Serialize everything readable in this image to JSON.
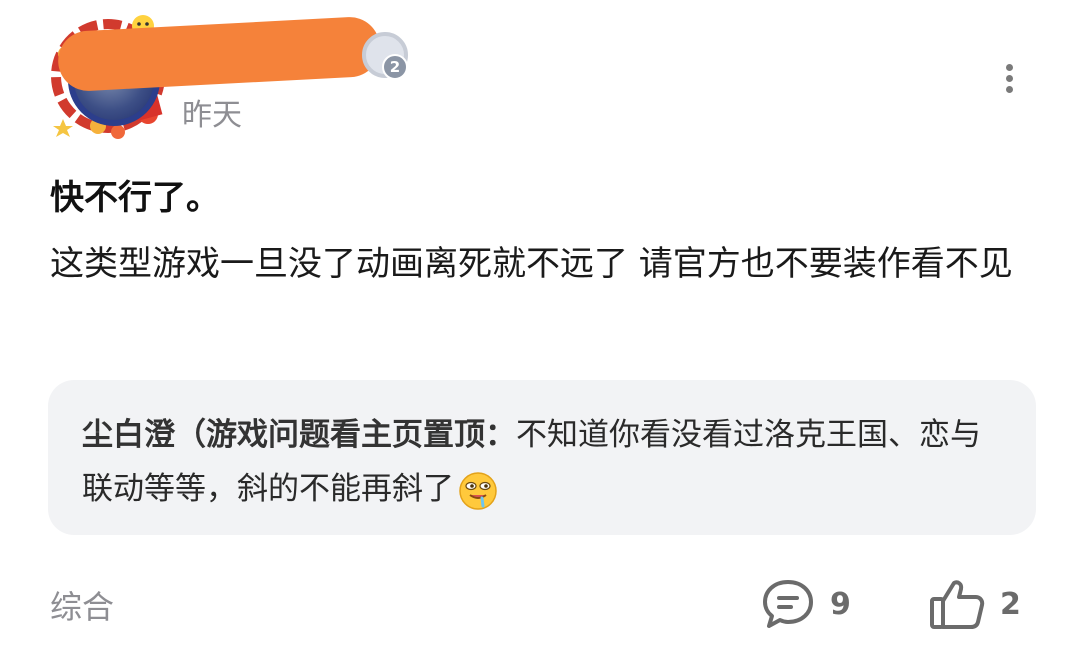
{
  "post": {
    "time": "昨天",
    "title": "快不行了。",
    "body": "这类型游戏一旦没了动画离死就不远了 请官方也不要装作看不见",
    "user_level": "2"
  },
  "quote": {
    "author": "尘白澄（游戏问题看主页置顶：",
    "text": "不知道你看没看过洛克王国、恋与联动等等，斜的不能再斜了",
    "emoji": "drooling-face"
  },
  "footer": {
    "tag": "综合",
    "comment_count": "9",
    "like_count": "2"
  },
  "colors": {
    "redaction": "#f5823a",
    "secondary_text": "#8e8e93",
    "quote_bg": "#f2f3f5"
  }
}
